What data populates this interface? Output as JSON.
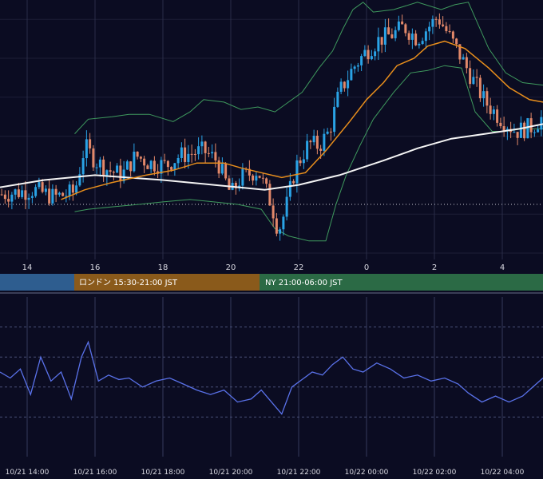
{
  "chart_data": [
    {
      "type": "candlestick",
      "panel": "price",
      "colors": {
        "background": "#0b0c22",
        "bullish": "#2aa3e6",
        "bearish": "#e2886a",
        "bollinger": "#3f9a5e",
        "ma_short": "#e88e1c",
        "ma_long": "#f4f4f4",
        "grid": "#2a2d48"
      },
      "x_ticks": [
        {
          "x": 14,
          "label": "14"
        },
        {
          "x": 16,
          "label": "16"
        },
        {
          "x": 18,
          "label": "18"
        },
        {
          "x": 20,
          "label": "20"
        },
        {
          "x": 22,
          "label": "22"
        },
        {
          "x": 24,
          "label": "0"
        },
        {
          "x": 26,
          "label": "2"
        },
        {
          "x": 28,
          "label": "4"
        }
      ],
      "x_range": [
        13.2,
        29.2
      ],
      "y_range": [
        0,
        100
      ],
      "dotted_level": 20,
      "ma_long": [
        [
          13.2,
          27
        ],
        [
          14.5,
          30
        ],
        [
          16,
          32
        ],
        [
          18,
          30
        ],
        [
          19.5,
          28
        ],
        [
          21,
          26
        ],
        [
          22,
          28
        ],
        [
          23.2,
          32
        ],
        [
          24.5,
          38
        ],
        [
          25.5,
          43
        ],
        [
          26.5,
          47
        ],
        [
          27.5,
          49
        ],
        [
          28.5,
          51
        ],
        [
          29.2,
          53
        ]
      ],
      "ma_short": [
        [
          15,
          22
        ],
        [
          15.7,
          26
        ],
        [
          16.5,
          29
        ],
        [
          17.5,
          32
        ],
        [
          18.3,
          34
        ],
        [
          19,
          37
        ],
        [
          19.8,
          37
        ],
        [
          20.3,
          35
        ],
        [
          20.9,
          33
        ],
        [
          21.5,
          31
        ],
        [
          22.2,
          33
        ],
        [
          22.8,
          42
        ],
        [
          23.5,
          54
        ],
        [
          24,
          63
        ],
        [
          24.5,
          70
        ],
        [
          24.9,
          77
        ],
        [
          25.4,
          80
        ],
        [
          25.8,
          85
        ],
        [
          26.3,
          87
        ],
        [
          26.9,
          84
        ],
        [
          27.6,
          76
        ],
        [
          28.2,
          68
        ],
        [
          28.8,
          63
        ],
        [
          29.2,
          62
        ]
      ],
      "bb_upper": [
        [
          15.4,
          49
        ],
        [
          15.8,
          55
        ],
        [
          16.5,
          56
        ],
        [
          17,
          57
        ],
        [
          17.6,
          57
        ],
        [
          18.3,
          54
        ],
        [
          18.8,
          58
        ],
        [
          19.2,
          63
        ],
        [
          19.8,
          62
        ],
        [
          20.3,
          59
        ],
        [
          20.8,
          60
        ],
        [
          21.3,
          58
        ],
        [
          21.7,
          62
        ],
        [
          22.1,
          66
        ],
        [
          22.6,
          76
        ],
        [
          23,
          83
        ],
        [
          23.3,
          92
        ],
        [
          23.6,
          100
        ],
        [
          23.9,
          103
        ],
        [
          24.2,
          99
        ],
        [
          24.8,
          100
        ],
        [
          25.5,
          103
        ],
        [
          26.2,
          100
        ],
        [
          26.6,
          102
        ],
        [
          27,
          103
        ],
        [
          27.6,
          84
        ],
        [
          28.1,
          74
        ],
        [
          28.6,
          70
        ],
        [
          29.2,
          69
        ]
      ],
      "bb_lower": [
        [
          15.4,
          17
        ],
        [
          15.8,
          18
        ],
        [
          16.5,
          19
        ],
        [
          17.3,
          20
        ],
        [
          18,
          21
        ],
        [
          18.8,
          22
        ],
        [
          19.5,
          21
        ],
        [
          20.2,
          20
        ],
        [
          20.9,
          18
        ],
        [
          21.3,
          10
        ],
        [
          21.7,
          7
        ],
        [
          22.3,
          5
        ],
        [
          22.8,
          5
        ],
        [
          23.1,
          20
        ],
        [
          23.4,
          32
        ],
        [
          23.8,
          44
        ],
        [
          24.2,
          55
        ],
        [
          24.8,
          66
        ],
        [
          25.3,
          74
        ],
        [
          25.8,
          75
        ],
        [
          26.3,
          77
        ],
        [
          26.8,
          76
        ],
        [
          27.2,
          58
        ],
        [
          27.7,
          50
        ],
        [
          28.1,
          50
        ],
        [
          28.6,
          51
        ],
        [
          29.2,
          51
        ]
      ],
      "candles_step": 0.1,
      "candles_start": 13.25,
      "close_path": [
        [
          13.2,
          24
        ],
        [
          14.2,
          26
        ],
        [
          14.8,
          23
        ],
        [
          15.4,
          25
        ],
        [
          15.7,
          44
        ],
        [
          16,
          38
        ],
        [
          16.4,
          34
        ],
        [
          16.8,
          32
        ],
        [
          17.2,
          40
        ],
        [
          17.6,
          37
        ],
        [
          18.1,
          36
        ],
        [
          18.5,
          40
        ],
        [
          19.2,
          42
        ],
        [
          19.6,
          38
        ],
        [
          20,
          24
        ],
        [
          20.3,
          31
        ],
        [
          20.8,
          34
        ],
        [
          21.2,
          20
        ],
        [
          21.4,
          9
        ],
        [
          21.6,
          17
        ],
        [
          21.9,
          35
        ],
        [
          22.3,
          45
        ],
        [
          22.6,
          44
        ],
        [
          22.9,
          50
        ],
        [
          23.2,
          66
        ],
        [
          23.6,
          76
        ],
        [
          24,
          83
        ],
        [
          24.4,
          88
        ],
        [
          24.8,
          90
        ],
        [
          25.1,
          93
        ],
        [
          25.5,
          88
        ],
        [
          26.1,
          97
        ],
        [
          26.4,
          90
        ],
        [
          26.8,
          80
        ],
        [
          27.1,
          72
        ],
        [
          27.5,
          62
        ],
        [
          27.9,
          56
        ],
        [
          28.4,
          50
        ],
        [
          28.9,
          52
        ],
        [
          29.2,
          56
        ]
      ]
    },
    {
      "type": "line",
      "panel": "oscillator",
      "colors": {
        "line": "#5a72ea",
        "grid": "#343a5c"
      },
      "x_range": [
        13.2,
        29.2
      ],
      "y_range": [
        0,
        100
      ],
      "dashed_levels": [
        20,
        40,
        60,
        80
      ],
      "points": [
        [
          13.2,
          50
        ],
        [
          13.5,
          46
        ],
        [
          13.8,
          52
        ],
        [
          14.1,
          35
        ],
        [
          14.4,
          60
        ],
        [
          14.7,
          44
        ],
        [
          15,
          50
        ],
        [
          15.3,
          32
        ],
        [
          15.6,
          60
        ],
        [
          15.8,
          70
        ],
        [
          16.1,
          44
        ],
        [
          16.4,
          48
        ],
        [
          16.7,
          45
        ],
        [
          17,
          46
        ],
        [
          17.4,
          40
        ],
        [
          17.8,
          44
        ],
        [
          18.2,
          46
        ],
        [
          18.6,
          42
        ],
        [
          19,
          38
        ],
        [
          19.4,
          35
        ],
        [
          19.8,
          38
        ],
        [
          20.2,
          30
        ],
        [
          20.6,
          32
        ],
        [
          20.9,
          38
        ],
        [
          21.2,
          30
        ],
        [
          21.5,
          22
        ],
        [
          21.8,
          40
        ],
        [
          22.1,
          45
        ],
        [
          22.4,
          50
        ],
        [
          22.7,
          48
        ],
        [
          23,
          55
        ],
        [
          23.3,
          60
        ],
        [
          23.6,
          52
        ],
        [
          23.9,
          50
        ],
        [
          24.3,
          56
        ],
        [
          24.7,
          52
        ],
        [
          25.1,
          46
        ],
        [
          25.5,
          48
        ],
        [
          25.9,
          44
        ],
        [
          26.3,
          46
        ],
        [
          26.7,
          42
        ],
        [
          27,
          36
        ],
        [
          27.4,
          30
        ],
        [
          27.8,
          34
        ],
        [
          28.2,
          30
        ],
        [
          28.6,
          34
        ],
        [
          29,
          42
        ],
        [
          29.2,
          46
        ]
      ]
    }
  ],
  "sessions": [
    {
      "label": "",
      "color": "#2e5d8f"
    },
    {
      "label": "ロンドン 15:30-21:00 JST",
      "color": "#8a5a1b"
    },
    {
      "label": "NY 21:00-06:00 JST",
      "color": "#2b6a45"
    }
  ],
  "bottom_ticks": [
    {
      "x": 14,
      "label": "10/21 14:00"
    },
    {
      "x": 16,
      "label": "10/21 16:00"
    },
    {
      "x": 18,
      "label": "10/21 18:00"
    },
    {
      "x": 20,
      "label": "10/21 20:00"
    },
    {
      "x": 22,
      "label": "10/21 22:00"
    },
    {
      "x": 24,
      "label": "10/22 00:00"
    },
    {
      "x": 26,
      "label": "10/22 02:00"
    },
    {
      "x": 28,
      "label": "10/22 04:00"
    }
  ]
}
